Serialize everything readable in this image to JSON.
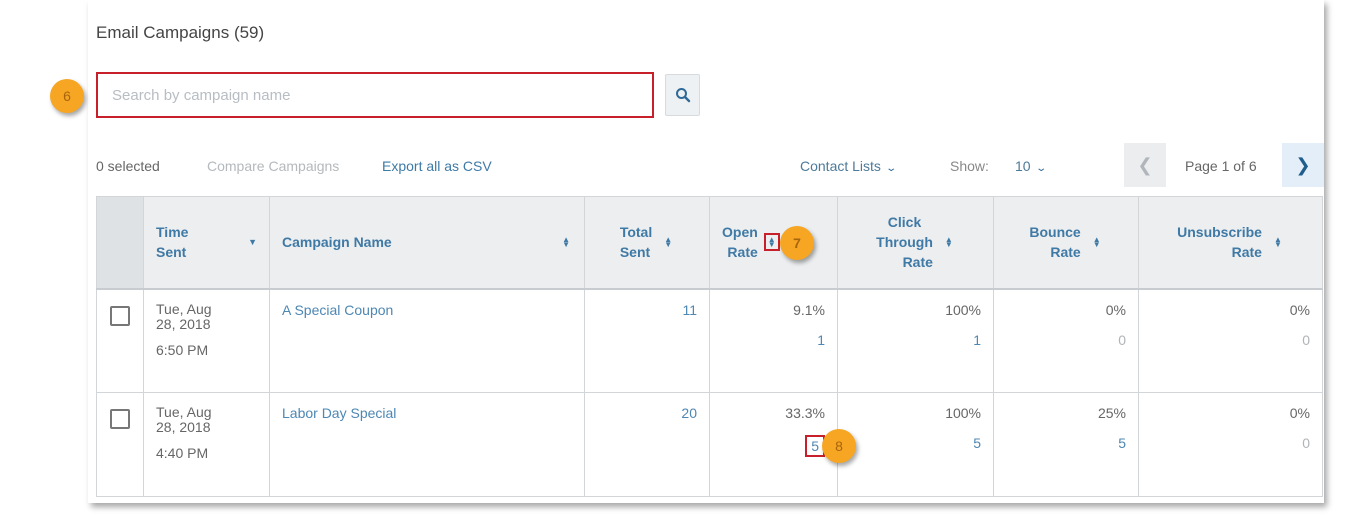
{
  "page": {
    "title": "Email Campaigns (59)"
  },
  "search": {
    "placeholder": "Search by campaign name",
    "value": "",
    "button_icon": "search-icon"
  },
  "callouts": {
    "search": "6",
    "sort": "7",
    "count": "8"
  },
  "toolbar": {
    "selected_label": "0 selected",
    "compare_label": "Compare Campaigns",
    "export_label": "Export all as CSV",
    "contact_lists_label": "Contact Lists",
    "show_label": "Show:",
    "show_value": "10",
    "page_label": "Page 1 of 6"
  },
  "table": {
    "columns": [
      {
        "label_line1": "Time",
        "label_line2": "Sent",
        "sort": "descending"
      },
      {
        "label_line1": "Campaign Name",
        "label_line2": "",
        "sort": "none"
      },
      {
        "label_line1": "Total",
        "label_line2": "Sent",
        "sort": "none"
      },
      {
        "label_line1": "Open",
        "label_line2": "Rate",
        "sort": "none"
      },
      {
        "label_line1": "Click",
        "label_line2": "Through",
        "label_line3": "Rate",
        "sort": "none"
      },
      {
        "label_line1": "Bounce",
        "label_line2": "Rate",
        "sort": "none"
      },
      {
        "label_line1": "Unsubscribe",
        "label_line2": "Rate",
        "sort": "none"
      }
    ],
    "rows": [
      {
        "checked": false,
        "date_line1": "Tue, Aug",
        "date_line2": "28, 2018",
        "time": "6:50 PM",
        "name": "A Special Coupon",
        "total_sent": "11",
        "open_rate": "9.1%",
        "open_count": "1",
        "click_rate": "100%",
        "click_count": "1",
        "bounce_rate": "0%",
        "bounce_count": "0",
        "unsub_rate": "0%",
        "unsub_count": "0"
      },
      {
        "checked": false,
        "date_line1": "Tue, Aug",
        "date_line2": "28, 2018",
        "time": "4:40 PM",
        "name": "Labor Day Special",
        "total_sent": "20",
        "open_rate": "33.3%",
        "open_count": "5",
        "click_rate": "100%",
        "click_count": "5",
        "bounce_rate": "25%",
        "bounce_count": "5",
        "unsub_rate": "0%",
        "unsub_count": "0"
      }
    ]
  },
  "colors": {
    "link": "#3e7aa6",
    "highlight_border": "#c8202a",
    "callout": "#f6a623",
    "header_bg": "#eceef0"
  }
}
